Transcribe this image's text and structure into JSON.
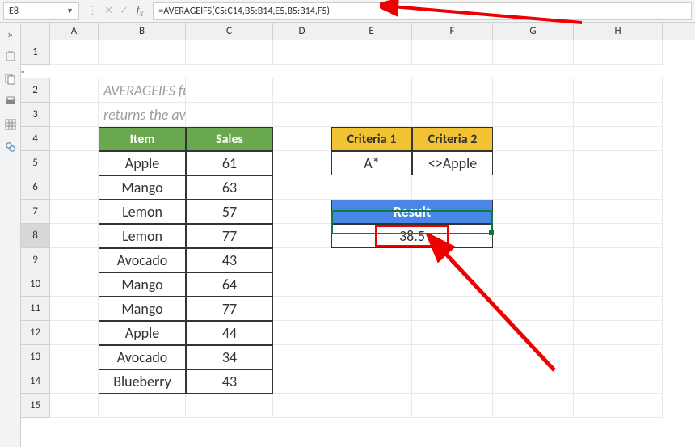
{
  "nameBox": "E8",
  "formula": "=AVERAGEIFS(C5:C14,B5:B14,E5,B5:B14,F5)",
  "columns": [
    "A",
    "B",
    "C",
    "D",
    "E",
    "F",
    "G",
    "H"
  ],
  "rowCount": 15,
  "selectedRow": 8,
  "description": {
    "title": "AVERAGEIFS function",
    "subtitle": "returns the average of numbers in a range that meet one or more criteria."
  },
  "dataTable": {
    "headers": {
      "item": "Item",
      "sales": "Sales"
    },
    "rows": [
      {
        "item": "Apple",
        "sales": "61"
      },
      {
        "item": "Mango",
        "sales": "63"
      },
      {
        "item": "Lemon",
        "sales": "57"
      },
      {
        "item": "Lemon",
        "sales": "77"
      },
      {
        "item": "Avocado",
        "sales": "43"
      },
      {
        "item": "Mango",
        "sales": "64"
      },
      {
        "item": "Mango",
        "sales": "77"
      },
      {
        "item": "Apple",
        "sales": "44"
      },
      {
        "item": "Avocado",
        "sales": "34"
      },
      {
        "item": "Blueberry",
        "sales": "43"
      }
    ]
  },
  "criteria": {
    "headers": {
      "c1": "Criteria 1",
      "c2": "Criteria 2"
    },
    "values": {
      "c1": "A*",
      "c2": "<>Apple"
    }
  },
  "result": {
    "label": "Result",
    "value": "38.5"
  },
  "icons": {
    "expand": "»",
    "cancel": "✕",
    "accept": "✓"
  }
}
